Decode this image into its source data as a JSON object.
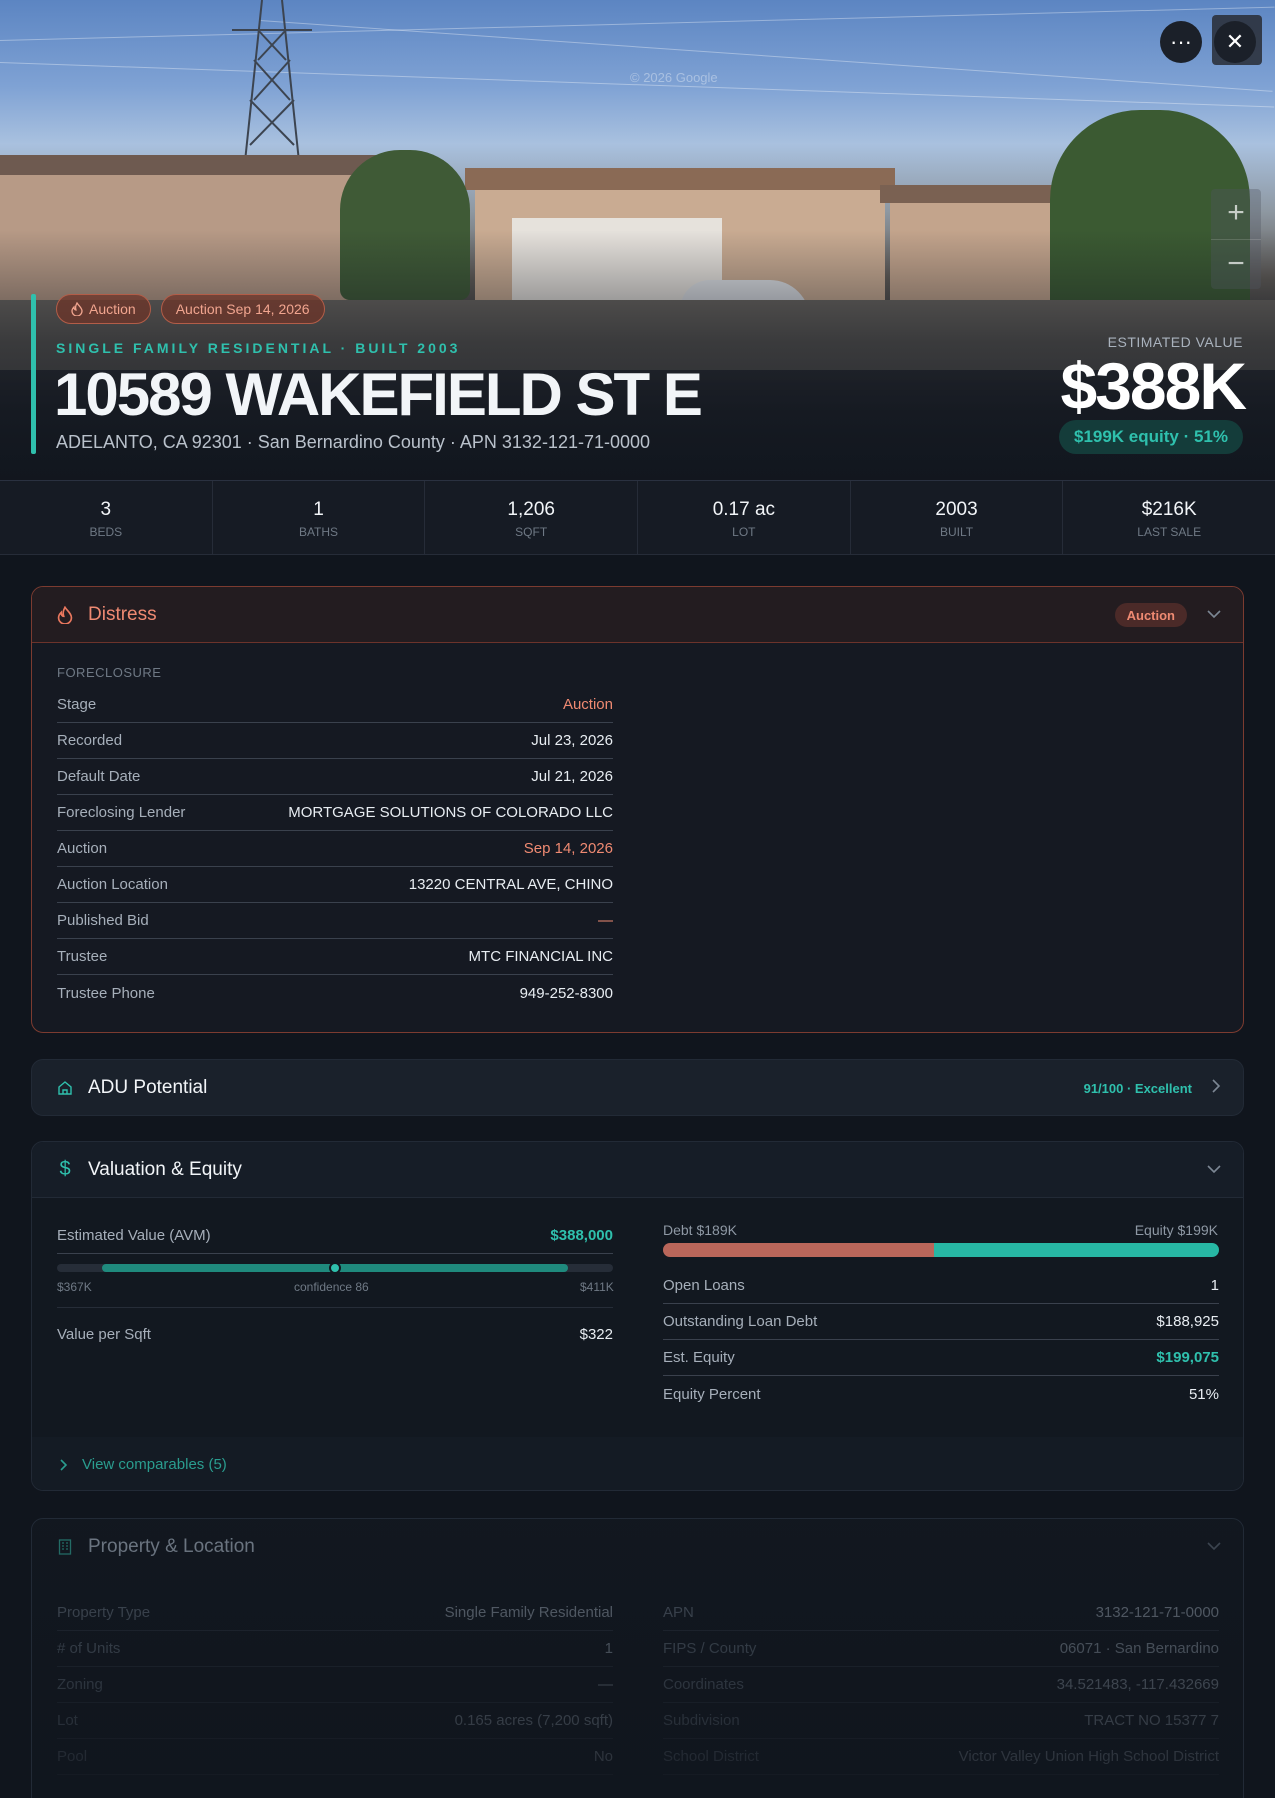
{
  "hero": {
    "watermark": "© 2026 Google",
    "more_label": "···",
    "close_label": "✕",
    "zoom_in_label": "+",
    "zoom_out_label": "−",
    "badges": [
      "Auction",
      "Auction Sep 14, 2026"
    ],
    "subtitle": "SINGLE FAMILY RESIDENTIAL · BUILT 2003",
    "title": "10589 WAKEFIELD ST E",
    "address": "ADELANTO, CA 92301 · San Bernardino County · APN 3132-121-71-0000",
    "estimated_label": "ESTIMATED VALUE",
    "estimated_value": "$388K",
    "equity_pill": "$199K equity · 51%"
  },
  "stats": [
    {
      "value": "3",
      "label": "BEDS"
    },
    {
      "value": "1",
      "label": "BATHS"
    },
    {
      "value": "1,206",
      "label": "SQFT"
    },
    {
      "value": "0.17 ac",
      "label": "LOT"
    },
    {
      "value": "2003",
      "label": "BUILT"
    },
    {
      "value": "$216K",
      "label": "LAST SALE"
    }
  ],
  "distress": {
    "title": "Distress",
    "badge": "Auction",
    "section": "FORECLOSURE",
    "rows": [
      {
        "k": "Stage",
        "v": "Auction"
      },
      {
        "k": "Recorded",
        "v": "Jul 23, 2026"
      },
      {
        "k": "Default Date",
        "v": "Jul 21, 2026"
      },
      {
        "k": "Foreclosing Lender",
        "v": "MORTGAGE SOLUTIONS OF COLORADO LLC"
      },
      {
        "k": "Auction",
        "v": "Sep 14, 2026"
      },
      {
        "k": "Auction Location",
        "v": "13220 CENTRAL AVE, CHINO"
      },
      {
        "k": "Published Bid",
        "v": "—"
      },
      {
        "k": "Trustee",
        "v": "MTC FINANCIAL INC"
      },
      {
        "k": "Trustee Phone",
        "v": "949-252-8300"
      }
    ]
  },
  "adu": {
    "title": "ADU Potential",
    "score": "91/100 · Excellent"
  },
  "valuation": {
    "title": "Valuation & Equity",
    "avm_label": "Estimated Value (AVM)",
    "avm_value": "$388,000",
    "range_low": "$367K",
    "range_mid": "confidence 86",
    "range_high": "$411K",
    "confidence": 86,
    "per_sqft_label": "Value per Sqft",
    "per_sqft_value": "$322",
    "debt_label": "Debt $189K",
    "equity_label": "Equity $199K",
    "debt_fraction": 0.487,
    "rows": [
      {
        "k": "Open Loans",
        "v": "1"
      },
      {
        "k": "Outstanding Loan Debt",
        "v": "$188,925"
      },
      {
        "k": "Est. Equity",
        "v": "$199,075"
      },
      {
        "k": "Equity Percent",
        "v": "51%"
      }
    ],
    "comparables": "View comparables (5)"
  },
  "property": {
    "title": "Property & Location",
    "left": [
      {
        "k": "Property Type",
        "v": "Single Family Residential"
      },
      {
        "k": "# of Units",
        "v": "1"
      },
      {
        "k": "Zoning",
        "v": "—"
      },
      {
        "k": "Lot",
        "v": "0.165 acres (7,200 sqft)"
      },
      {
        "k": "Pool",
        "v": "No"
      }
    ],
    "right": [
      {
        "k": "APN",
        "v": "3132-121-71-0000"
      },
      {
        "k": "FIPS / County",
        "v": "06071 · San Bernardino"
      },
      {
        "k": "Coordinates",
        "v": "34.521483, -117.432669"
      },
      {
        "k": "Subdivision",
        "v": "TRACT NO 15377 7"
      },
      {
        "k": "School District",
        "v": "Victor Valley Union High School District"
      }
    ]
  },
  "colors": {
    "accent": "#2fc0ad",
    "distress": "#ef8a72",
    "background": "#10151d"
  }
}
